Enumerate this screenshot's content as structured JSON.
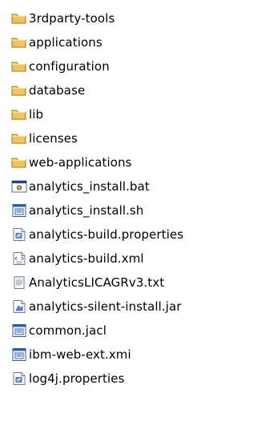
{
  "items": [
    {
      "label": "3rdparty-tools",
      "icon": "folder-icon",
      "type": "folder"
    },
    {
      "label": "applications",
      "icon": "folder-icon",
      "type": "folder"
    },
    {
      "label": "configuration",
      "icon": "folder-icon",
      "type": "folder"
    },
    {
      "label": "database",
      "icon": "folder-icon",
      "type": "folder"
    },
    {
      "label": "lib",
      "icon": "folder-icon",
      "type": "folder"
    },
    {
      "label": "licenses",
      "icon": "folder-icon",
      "type": "folder"
    },
    {
      "label": "web-applications",
      "icon": "folder-icon",
      "type": "folder"
    },
    {
      "label": "analytics_install.bat",
      "icon": "batch-file-icon",
      "type": "bat"
    },
    {
      "label": "analytics_install.sh",
      "icon": "script-file-icon",
      "type": "script"
    },
    {
      "label": "analytics-build.properties",
      "icon": "properties-file-icon",
      "type": "properties"
    },
    {
      "label": "analytics-build.xml",
      "icon": "xml-file-icon",
      "type": "xml"
    },
    {
      "label": "AnalyticsLICAGRv3.txt",
      "icon": "text-file-icon",
      "type": "text"
    },
    {
      "label": "analytics-silent-install.jar",
      "icon": "jar-file-icon",
      "type": "jar"
    },
    {
      "label": "common.jacl",
      "icon": "script-file-icon",
      "type": "script"
    },
    {
      "label": "ibm-web-ext.xmi",
      "icon": "script-file-icon",
      "type": "script"
    },
    {
      "label": "log4j.properties",
      "icon": "properties-file-icon",
      "type": "properties"
    }
  ],
  "colors": {
    "folder_body": "#f2c35a",
    "folder_tab": "#e9b04a",
    "folder_outline": "#a07820",
    "file_outline": "#6b7a90",
    "script_blue": "#2a5db0",
    "bat_window": "#1f3f8f"
  }
}
